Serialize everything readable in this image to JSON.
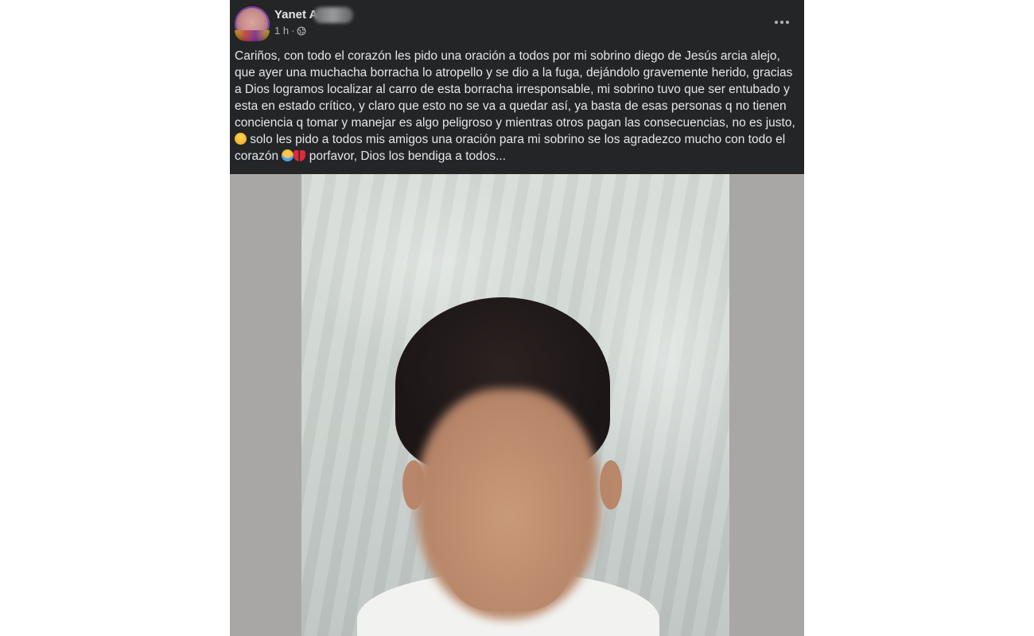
{
  "post": {
    "author": "Yanet A",
    "time": "1 h",
    "audience_icon": "globe-icon",
    "more_icon": "more-horizontal-icon",
    "text_parts": [
      "Cariños, con todo el corazón les pido una oración a todos por mi sobrino diego de Jesús arcia alejo, que ayer una muchacha borracha lo atropello y se dio a la fuga, dejándolo gravemente herido, gracias a Dios logramos localizar al carro de esta borracha irresponsable, mi sobrino tuvo que ser entubado y esta en estado crítico, y claro que esto no se va a quedar así, ya basta de esas personas q no tienen conciencia q tomar y manejar es algo peligroso y mientras otros pagan las consecuencias, no es justo, ",
      " solo les pido a todos mis amigos una oración para mi sobrino se los agradezco mucho con todo el corazón ",
      " porfavor, Dios los bendiga a todos..."
    ],
    "emojis": [
      "pensive-face",
      "loudly-crying-face",
      "broken-heart"
    ]
  },
  "colors": {
    "post_bg": "#242526",
    "text": "#e4e6eb",
    "secondary_text": "#b0b3b8",
    "photo_backdrop": "#a9a7a6"
  }
}
